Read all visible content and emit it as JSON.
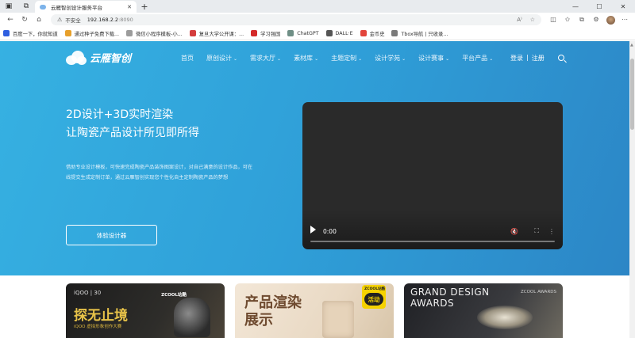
{
  "browser": {
    "tab_title": "云雁智创设计服务平台",
    "new_tab": "+",
    "window_minimize": "—",
    "window_maximize": "☐",
    "window_close": "✕",
    "url_warning": "不安全",
    "url_host": "192.168.2.2",
    "url_port": ":8090",
    "read_aloud_label": "A⁾"
  },
  "bookmarks": [
    {
      "label": "百度一下，你就知道",
      "color": "#2f5fe0"
    },
    {
      "label": "通过种子免费下载...",
      "color": "#e7a02b"
    },
    {
      "label": "微信小程序模板-小...",
      "color": "#9c9c9c"
    },
    {
      "label": "复旦大学公开课：...",
      "color": "#d43d3d"
    },
    {
      "label": "学习强国",
      "color": "#d42a2a"
    },
    {
      "label": "ChatGPT",
      "color": "#6f8f86"
    },
    {
      "label": "DALL·E",
      "color": "#555555"
    },
    {
      "label": "金币史",
      "color": "#e2443b"
    },
    {
      "label": "Tbox导航 | 只收录...",
      "color": "#7a7a7a"
    }
  ],
  "site": {
    "logo_text": "云雁智创",
    "nav": [
      {
        "label": "首页",
        "dropdown": false
      },
      {
        "label": "原创设计",
        "dropdown": true
      },
      {
        "label": "需求大厅",
        "dropdown": true
      },
      {
        "label": "素材库",
        "dropdown": true
      },
      {
        "label": "主题定制",
        "dropdown": true
      },
      {
        "label": "设计学苑",
        "dropdown": true
      },
      {
        "label": "设计赛事",
        "dropdown": true
      },
      {
        "label": "平台产品",
        "dropdown": true
      }
    ],
    "login": "登录",
    "auth_sep": "|",
    "register": "注册"
  },
  "hero": {
    "title_line1": "2D设计+3D实时渲染",
    "title_line2": "让陶瓷产品设计所见即所得",
    "description": "借助专业设计模板，可快速完成陶瓷产品装饰图案设计，对自己满意的设计作品，可在线提交生成定制订单，通过云雁智创实现您个性化自主定制陶瓷产品的梦想",
    "cta": "体验设计器",
    "video_time": "0:00"
  },
  "cards": [
    {
      "brand": "iQOO | 30",
      "zcool": "ZCOOL站酷",
      "title": "探无止境",
      "subtitle": "iQOO 虚拟形象创作大赛"
    },
    {
      "title_line1": "产品渲染",
      "title_line2": "展示",
      "badge_top": "ZCOOL站酷",
      "badge_main": "活动"
    },
    {
      "title_line1": "GRAND DESIGN",
      "title_line2": "AWARDS",
      "zcool": "ZCOOL AWARDS"
    }
  ]
}
